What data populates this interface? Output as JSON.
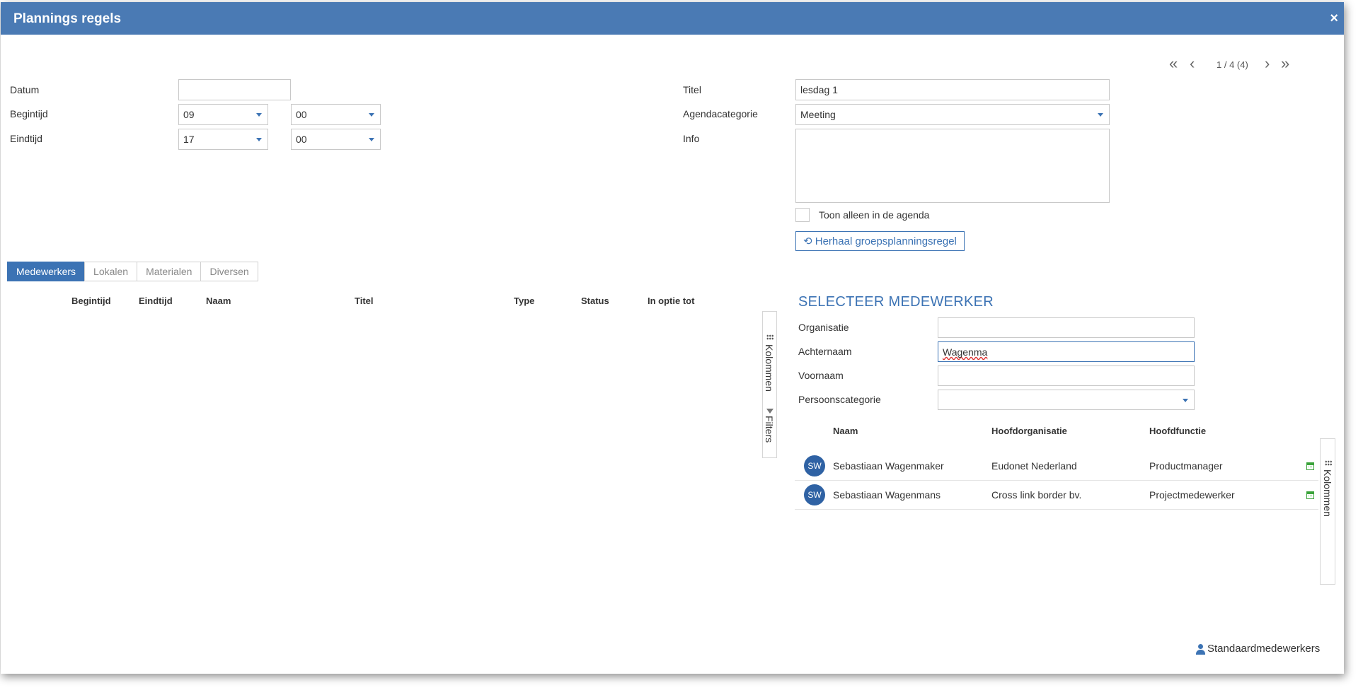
{
  "window": {
    "title": "Plannings regels",
    "close": "×"
  },
  "pager": {
    "text": "1 / 4 (4)"
  },
  "form_left": {
    "datum_label": "Datum",
    "datum_value": "",
    "begintijd_label": "Begintijd",
    "begintijd_hour": "09",
    "begintijd_min": "00",
    "eindtijd_label": "Eindtijd",
    "eindtijd_hour": "17",
    "eindtijd_min": "00"
  },
  "form_right": {
    "titel_label": "Titel",
    "titel_value": "lesdag 1",
    "agendacategorie_label": "Agendacategorie",
    "agendacategorie_value": "Meeting",
    "info_label": "Info",
    "info_value": "",
    "toon_label": "Toon alleen in de agenda",
    "herhaal_label": "Herhaal groepsplanningsregel"
  },
  "tabs": [
    "Medewerkers",
    "Lokalen",
    "Materialen",
    "Diversen"
  ],
  "left_table": {
    "columns": [
      "Begintijd",
      "Eindtijd",
      "Naam",
      "Titel",
      "Type",
      "Status",
      "In optie tot"
    ],
    "side_kolommen": "Kolommen",
    "side_filters": "Filters"
  },
  "select_panel": {
    "title": "SELECTEER MEDEWERKER",
    "organisatie_label": "Organisatie",
    "organisatie_value": "",
    "achternaam_label": "Achternaam",
    "achternaam_value": "Wagenma",
    "voornaam_label": "Voornaam",
    "voornaam_value": "",
    "persoonscategorie_label": "Persoonscategorie",
    "persoonscategorie_value": "",
    "columns": [
      "Naam",
      "Hoofdorganisatie",
      "Hoofdfunctie"
    ],
    "rows": [
      {
        "initials": "SW",
        "naam": "Sebastiaan Wagenmaker",
        "organisatie": "Eudonet Nederland",
        "functie": "Productmanager"
      },
      {
        "initials": "SW",
        "naam": "Sebastiaan Wagenmans",
        "organisatie": "Cross link border bv.",
        "functie": "Projectmedewerker"
      }
    ],
    "side_kolommen": "Kolommen"
  },
  "footer": {
    "standaard_label": "Standaardmedewerkers"
  },
  "colors": {
    "header": "#4a7ab4",
    "accent": "#3c73b4",
    "calendar_icon": "#3aa33a"
  },
  "icons": [
    "close-icon",
    "first-page-icon",
    "prev-page-icon",
    "next-page-icon",
    "last-page-icon",
    "caret-down-icon",
    "refresh-icon",
    "grip-icon",
    "filter-icon",
    "calendar-icon",
    "person-icon"
  ]
}
